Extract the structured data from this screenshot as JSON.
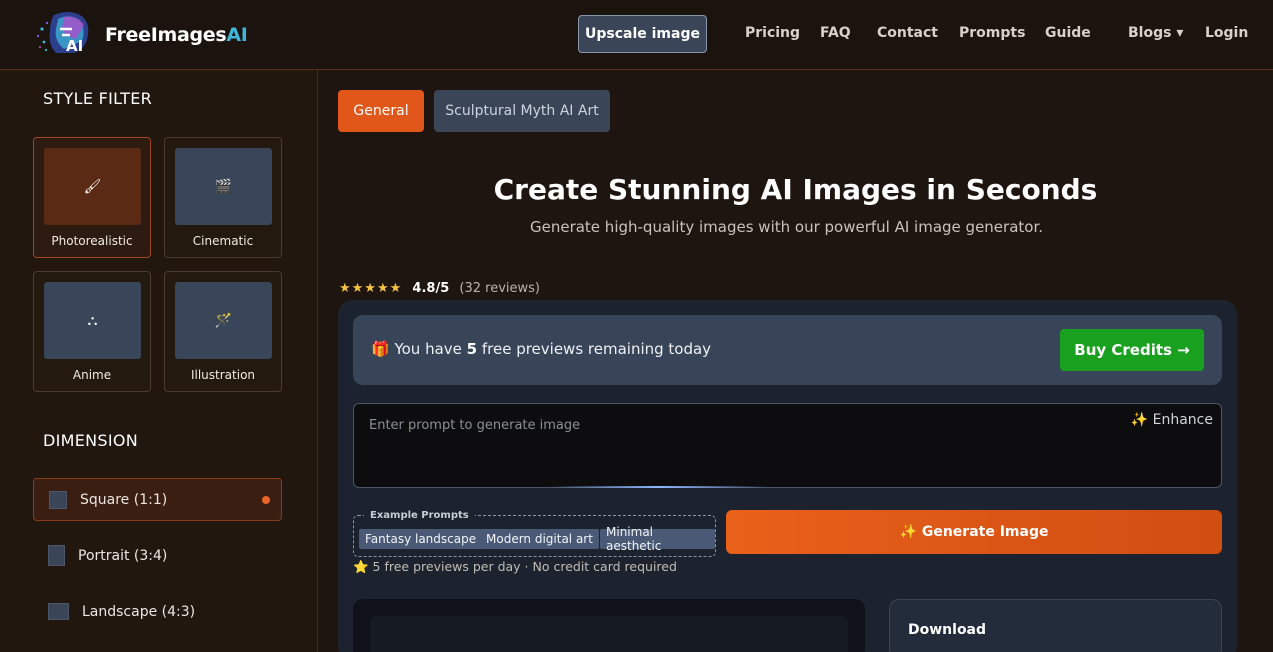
{
  "header": {
    "brand_text": "FreeImages",
    "brand_ai": "AI",
    "logo_icon": "freeimagesai-logo-icon",
    "upscale_label": "Upscale image",
    "nav": [
      {
        "label": "Pricing"
      },
      {
        "label": "FAQ"
      },
      {
        "label": "Contact"
      },
      {
        "label": "Prompts"
      },
      {
        "label": "Guide"
      },
      {
        "label": "Blogs ▾"
      },
      {
        "label": "Login"
      }
    ]
  },
  "sidebar": {
    "style_title": "STYLE FILTER",
    "styles": [
      {
        "label": "Photorealistic",
        "icon": "paintbrush-icon",
        "glyph": "🖌",
        "active": true
      },
      {
        "label": "Cinematic",
        "icon": "clapperboard-icon",
        "glyph": "🎬",
        "active": false
      },
      {
        "label": "Anime",
        "icon": "shapes-icon",
        "glyph": "⛬",
        "active": false
      },
      {
        "label": "Illustration",
        "icon": "magic-wand-icon",
        "glyph": "🪄",
        "active": false
      }
    ],
    "dimension_title": "DIMENSION",
    "dimensions": [
      {
        "label": "Square (1:1)",
        "active": true
      },
      {
        "label": "Portrait (3:4)",
        "active": false
      },
      {
        "label": "Landscape (4:3)",
        "active": false
      }
    ]
  },
  "tabs": [
    {
      "label": "General",
      "active": true
    },
    {
      "label": "Sculptural Myth AI Art",
      "active": false
    }
  ],
  "hero": {
    "title": "Create Stunning AI Images in Seconds",
    "subtitle": "Generate high-quality images with our powerful AI image generator."
  },
  "rating": {
    "stars": "★★★★★",
    "score": "4.8/5",
    "count": "(32 reviews)"
  },
  "credits": {
    "prefix": "🎁 You have ",
    "number": "5",
    "suffix": " free previews remaining today",
    "buy_label": "Buy Credits →"
  },
  "prompt": {
    "placeholder": "Enter prompt to generate image",
    "enhance_label": "✨ Enhance"
  },
  "examples": {
    "label": "Example Prompts",
    "chips": [
      "Fantasy landscape",
      "Modern digital art",
      "Minimal aesthetic"
    ]
  },
  "free_note": "⭐ 5 free previews per day · No credit card required",
  "generate_label": "✨ Generate Image",
  "download": {
    "title": "Download"
  },
  "colors": {
    "accent": "#e1571a",
    "buy_green": "#19a01f",
    "slate": "#3a4558",
    "brand_ai": "#3fb6d8"
  }
}
